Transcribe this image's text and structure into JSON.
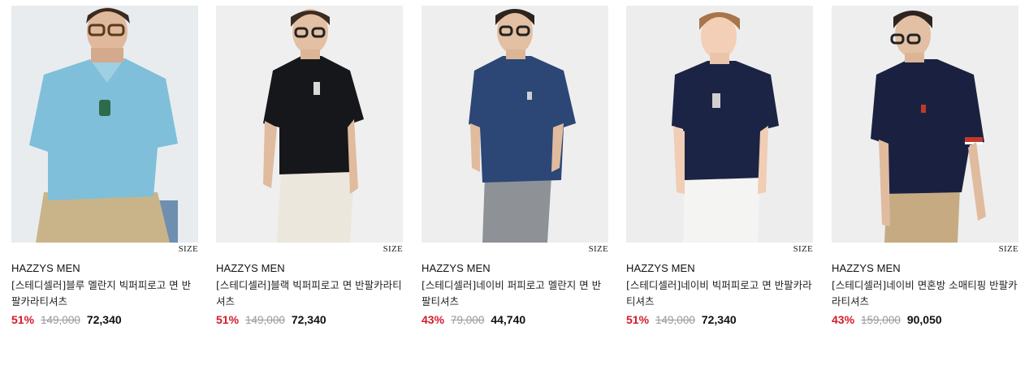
{
  "products": [
    {
      "brand": "HAZZYS MEN",
      "name": "[스테디셀러]블루 멜란지 빅퍼피로고 면 반팔카라티셔츠",
      "discount": "51%",
      "original_price": "149,000",
      "sale_price": "72,340",
      "size_label": "SIZE",
      "shirt_color": "#7fbfd9",
      "pants_color": "#c9b48a",
      "logo_color": "#2d6b4a"
    },
    {
      "brand": "HAZZYS MEN",
      "name": "[스테디셀러]블랙 빅퍼피로고 면 반팔카라티셔츠",
      "discount": "51%",
      "original_price": "149,000",
      "sale_price": "72,340",
      "size_label": "SIZE",
      "shirt_color": "#16171b",
      "pants_color": "#ece7dc",
      "logo_color": "#d9d9d9"
    },
    {
      "brand": "HAZZYS MEN",
      "name": "[스테디셀러]네이비 퍼피로고 멜란지 면 반팔티셔츠",
      "discount": "43%",
      "original_price": "79,000",
      "sale_price": "44,740",
      "size_label": "SIZE",
      "shirt_color": "#2c4676",
      "pants_color": "#8e9297",
      "logo_color": "#cfcfcf"
    },
    {
      "brand": "HAZZYS MEN",
      "name": "[스테디셀러]네이비 빅퍼피로고 면 반팔카라티셔츠",
      "discount": "51%",
      "original_price": "149,000",
      "sale_price": "72,340",
      "size_label": "SIZE",
      "shirt_color": "#1b2444",
      "pants_color": "#f4f4f2",
      "logo_color": "#d0d0d0"
    },
    {
      "brand": "HAZZYS MEN",
      "name": "[스테디셀러]네이비 면혼방 소매티핑 반팔카라티셔츠",
      "discount": "43%",
      "original_price": "159,000",
      "sale_price": "90,050",
      "size_label": "SIZE",
      "shirt_color": "#1a2140",
      "pants_color": "#c6ab82",
      "logo_color": "#c0392b"
    }
  ]
}
